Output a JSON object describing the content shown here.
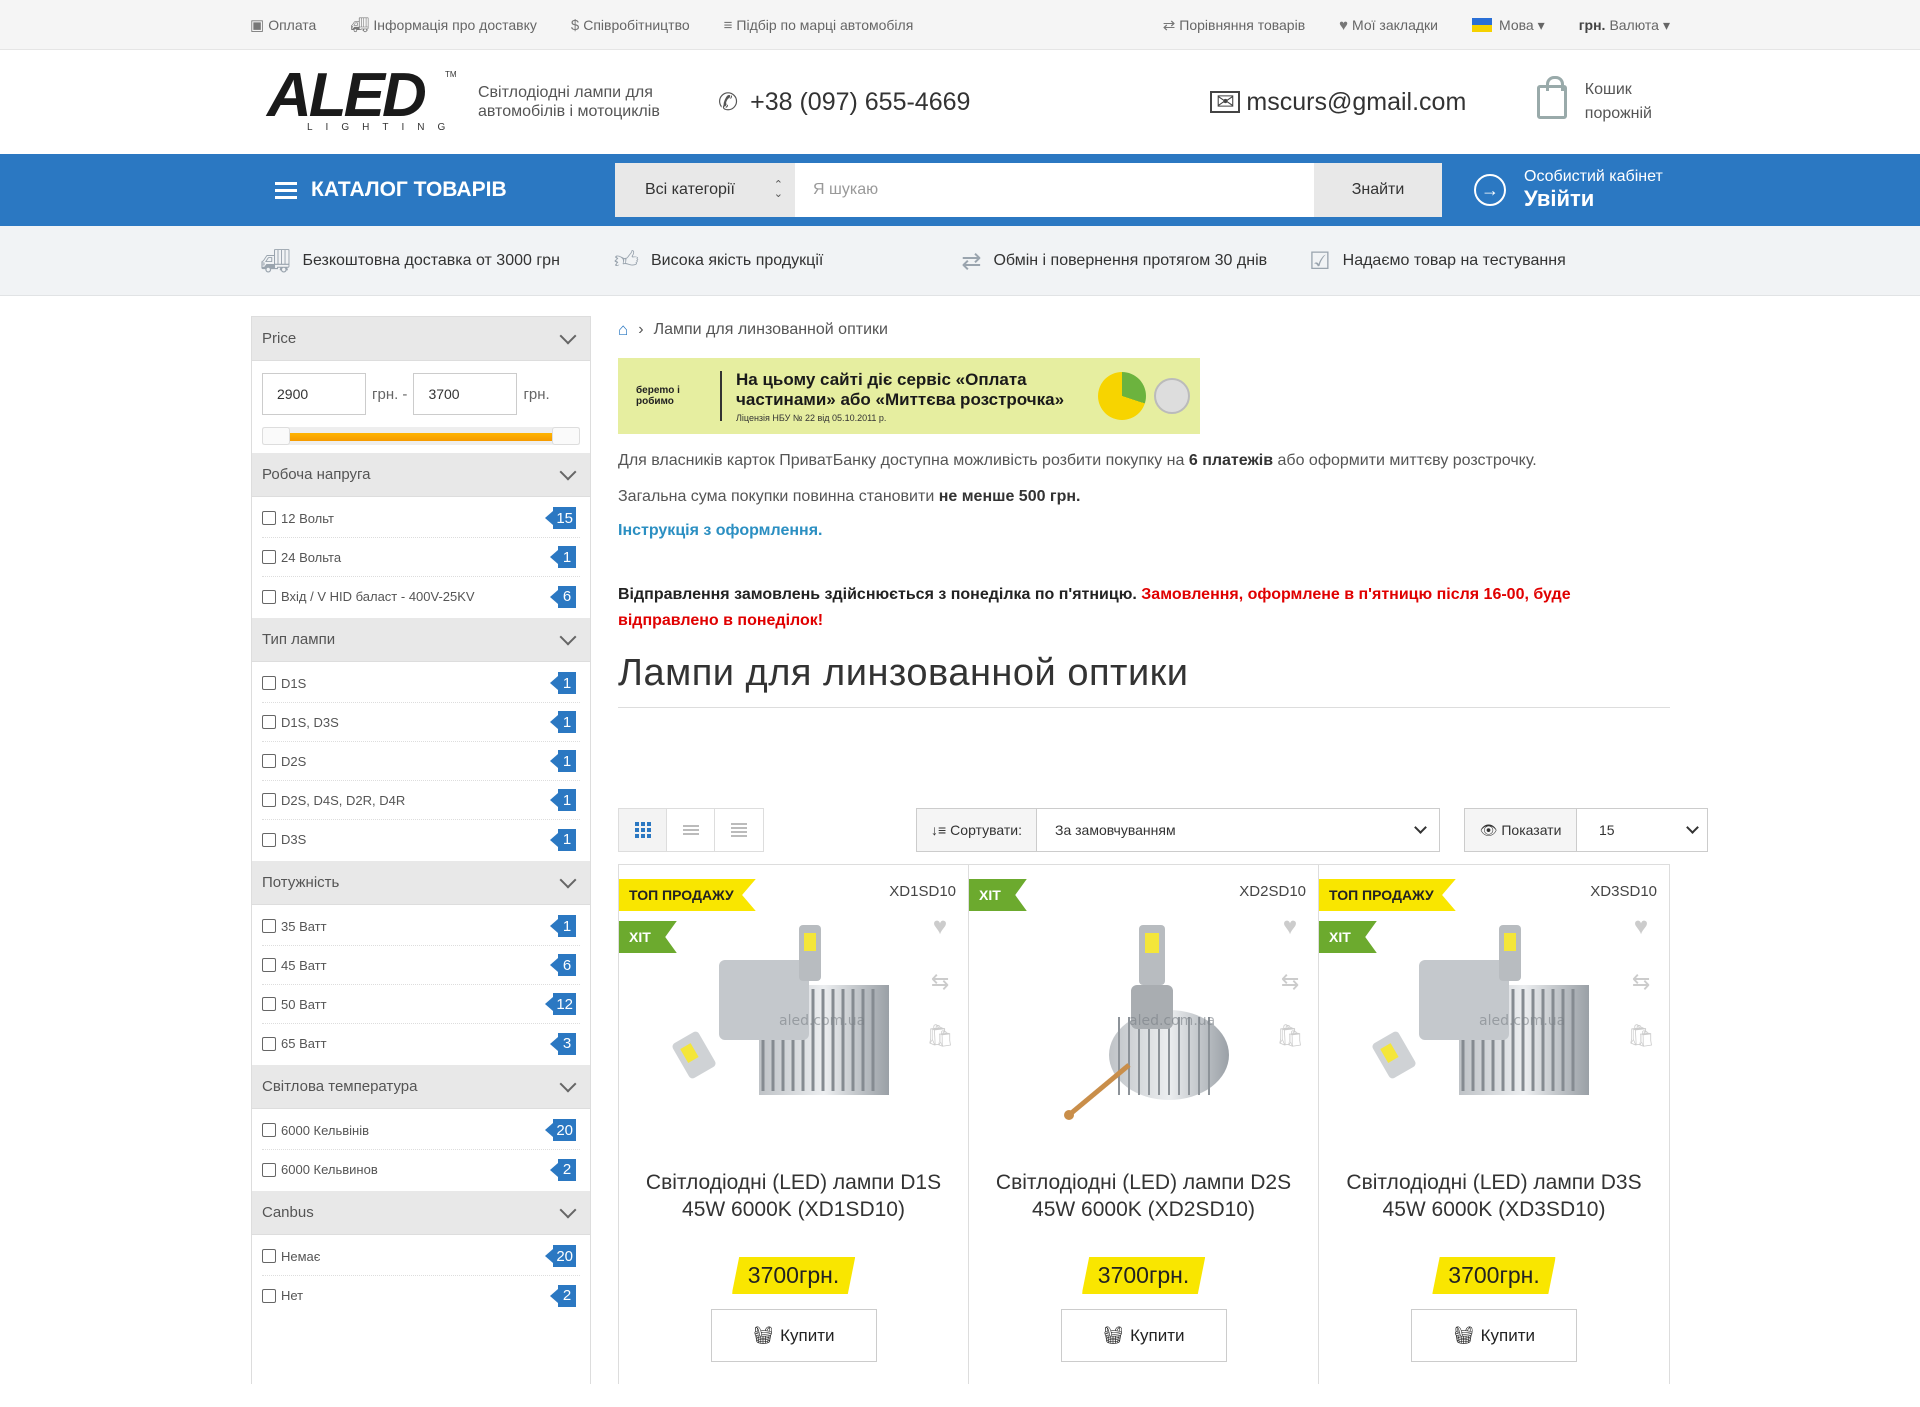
{
  "topbar": {
    "left": [
      {
        "icon": "money-icon",
        "label": "Оплата"
      },
      {
        "icon": "truck-icon",
        "label": "Інформація про доставку"
      },
      {
        "icon": "dollar-icon",
        "label": "Співробітництво"
      },
      {
        "icon": "list-icon",
        "label": "Підбір по марці автомобіля"
      }
    ],
    "compare": "Порівняння товарів",
    "bookmarks": "Мої закладки",
    "language": "Мова",
    "currency_code": "грн.",
    "currency_label": "Валюта"
  },
  "header": {
    "logo_text": "ALED",
    "logo_sub": "LIGHTING",
    "tagline": "Світлодіодні лампи для автомобілів і мотоциклів",
    "phone": "+38 (097) 655-4669",
    "email": "mscurs@gmail.com",
    "cart_l1": "Кошик",
    "cart_l2": "порожній"
  },
  "nav": {
    "catalog": "КАТАЛОГ ТОВАРІВ",
    "search_category": "Всі категорії",
    "search_placeholder": "Я шукаю",
    "search_button": "Знайти",
    "account_l1": "Особистий кабінет",
    "account_l2": "Увійти"
  },
  "benefits": [
    {
      "icon": "truck-icon",
      "text": "Безкоштовна доставка от 3000 грн"
    },
    {
      "icon": "thumbs-up-icon",
      "text": "Висока якість продукції"
    },
    {
      "icon": "exchange-icon",
      "text": "Обмін і повернення протягом 30 днів"
    },
    {
      "icon": "check-square-icon",
      "text": "Надаємо товар на тестування"
    }
  ],
  "filters": {
    "price": {
      "title": "Price",
      "min": "2900",
      "max": "3700",
      "unit": "грн.",
      "sep": "грн. -"
    },
    "groups": [
      {
        "title": "Робоча напруга",
        "options": [
          {
            "label": "12 Вольт",
            "count": "15"
          },
          {
            "label": "24 Вольта",
            "count": "1"
          },
          {
            "label": "Вхід / V HID баласт - 400V-25KV",
            "count": "6"
          }
        ]
      },
      {
        "title": "Тип лампи",
        "options": [
          {
            "label": "D1S",
            "count": "1"
          },
          {
            "label": "D1S, D3S",
            "count": "1"
          },
          {
            "label": "D2S",
            "count": "1"
          },
          {
            "label": "D2S, D4S, D2R, D4R",
            "count": "1"
          },
          {
            "label": "D3S",
            "count": "1"
          }
        ]
      },
      {
        "title": "Потужність",
        "options": [
          {
            "label": "35 Ватт",
            "count": "1"
          },
          {
            "label": "45 Ватт",
            "count": "6"
          },
          {
            "label": "50 Ватт",
            "count": "12"
          },
          {
            "label": "65 Ватт",
            "count": "3"
          }
        ]
      },
      {
        "title": "Світлова температура",
        "options": [
          {
            "label": "6000 Кельвінів",
            "count": "20"
          },
          {
            "label": "6000 Кельвинов",
            "count": "2"
          }
        ]
      },
      {
        "title": "Canbus",
        "options": [
          {
            "label": "Немає",
            "count": "20"
          },
          {
            "label": "Нет",
            "count": "2"
          }
        ]
      }
    ]
  },
  "content": {
    "breadcrumb": "Лампи для линзованной оптики",
    "banner_logo": "берemo і робимо",
    "banner_title": "На цьому сайті діє сервіс «Оплата частинами» або «Миттєва розстрочка»",
    "banner_license": "Ліцензія НБУ № 22 від 05.10.2011 р.",
    "p1_a": "Для власників карток ПриватБанку доступна можливість розбити покупку на ",
    "p1_b": "6 платежів",
    "p1_c": " або оформити миттєву розстрочку.",
    "p2_a": "Загальна сума покупки повинна становити ",
    "p2_b": "не менше 500 грн.",
    "link": "Інструкція з оформлення.",
    "notice_black": "Відправлення замовлень здійснюється з понеділка по п'ятницю. ",
    "notice_red": "Замовлення, оформлене в п'ятницю після 16-00, буде відправлено в понеділок!",
    "title": "Лампи для линзованной оптики"
  },
  "toolbar": {
    "sort_label": "Сортувати:",
    "sort_value": "За замовчуванням",
    "show_label": "Показати",
    "show_value": "15"
  },
  "products": [
    {
      "sku": "XD1SD10",
      "top": "ТОП ПРОДАЖУ",
      "hit": "ХІТ",
      "title": "Світлодіодні (LED) лампи D1S 45W 6000K (XD1SD10)",
      "price": "3700грн.",
      "buy": "Купити",
      "watermark": "aled.com.ua"
    },
    {
      "sku": "XD2SD10",
      "top": "",
      "hit": "ХІТ",
      "title": "Світлодіодні (LED) лампи D2S 45W 6000K (XD2SD10)",
      "price": "3700грн.",
      "buy": "Купити",
      "watermark": "aled.com.ua"
    },
    {
      "sku": "XD3SD10",
      "top": "ТОП ПРОДАЖУ",
      "hit": "ХІТ",
      "title": "Світлодіодні (LED) лампи D3S 45W 6000K (XD3SD10)",
      "price": "3700грн.",
      "buy": "Купити",
      "watermark": "aled.com.ua"
    }
  ],
  "colors": {
    "primary": "#2b78c2",
    "yellow": "#f9e600",
    "green": "#6caa2e",
    "red": "#e00000"
  }
}
